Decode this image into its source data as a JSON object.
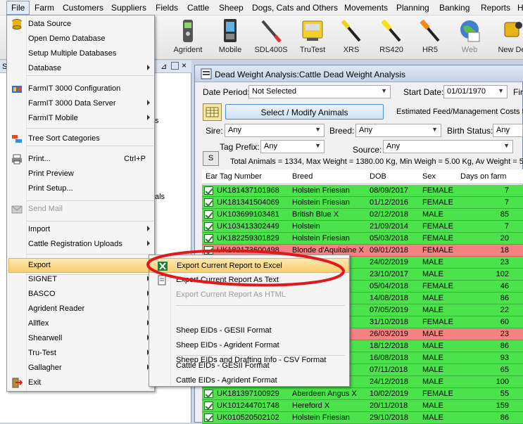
{
  "menubar": [
    "File",
    "Farm",
    "Customers",
    "Suppliers",
    "Fields",
    "Cattle",
    "Sheep",
    "Dogs, Cats and Others",
    "Movements",
    "Planning",
    "Banking",
    "Reports",
    "H"
  ],
  "toolbar": [
    {
      "label": "Agrident",
      "icon": "agrident-reader-icon"
    },
    {
      "label": "Mobile",
      "icon": "mobile-device-icon"
    },
    {
      "label": "SDL400S",
      "icon": "sdl400s-wand-icon"
    },
    {
      "label": "TruTest",
      "icon": "trutest-indicator-icon"
    },
    {
      "label": "XRS",
      "icon": "xrs-wand-icon"
    },
    {
      "label": "RS420",
      "icon": "rs420-wand-icon"
    },
    {
      "label": "HR5",
      "icon": "hr5-wand-icon"
    },
    {
      "label": "Web",
      "icon": "globe-icon"
    },
    {
      "label": "New De",
      "icon": "new-device-icon"
    }
  ],
  "left_panel": {
    "fragments": [
      "S",
      "s",
      "als"
    ]
  },
  "window": {
    "title": "Dead Weight Analysis:Cattle Dead Weight Analysis",
    "date_period_label": "Date Period:",
    "date_period_value": "Not Selected",
    "start_date_label": "Start Date:",
    "start_date_value": "01/01/1970",
    "fin_label": "Fin",
    "select_button": "Select / Modify Animals",
    "feed_costs_label": "Estimated Feed/Management Costs P",
    "sire_label": "Sire:",
    "sire_value": "Any",
    "breed_label": "Breed:",
    "breed_value": "Any",
    "birth_status_label": "Birth Status:",
    "birth_status_value": "Any",
    "tag_prefix_label": "Tag Prefix:",
    "tag_prefix_value": "Any",
    "source_label": "Source:",
    "source_value": "Any",
    "s_button": "S",
    "summary": "Total Animals = 1334, Max Weight = 1380.00 Kg, Min Weigh = 5.00 Kg, Av Weight = 5"
  },
  "grid": {
    "columns": [
      "Ear Tag Number",
      "Breed",
      "DOB",
      "Sex",
      "Days on farm"
    ],
    "rows": [
      {
        "tag": "UK181437101968",
        "breed": "Holstein Friesian",
        "dob": "08/09/2017",
        "sex": "FEMALE",
        "days": "7",
        "status": "ok"
      },
      {
        "tag": "UK181341504069",
        "breed": "Holstein Friesian",
        "dob": "01/12/2016",
        "sex": "FEMALE",
        "days": "7",
        "status": "ok"
      },
      {
        "tag": "UK103699103481",
        "breed": "British Blue X",
        "dob": "02/12/2018",
        "sex": "MALE",
        "days": "85",
        "status": "ok"
      },
      {
        "tag": "UK103413302449",
        "breed": "Holstein",
        "dob": "21/09/2014",
        "sex": "FEMALE",
        "days": "7",
        "status": "ok"
      },
      {
        "tag": "UK182259301829",
        "breed": "Holstein Friesian",
        "dob": "05/03/2018",
        "sex": "FEMALE",
        "days": "20",
        "status": "ok"
      },
      {
        "tag": "UK182173600498",
        "breed": "Blonde d'Aquitaine X",
        "dob": "09/01/2018",
        "sex": "FEMALE",
        "days": "18",
        "status": "alert"
      },
      {
        "tag": "",
        "breed": "",
        "dob": "24/02/2019",
        "sex": "MALE",
        "days": "23",
        "status": "ok"
      },
      {
        "tag": "",
        "breed": "X",
        "dob": "23/10/2017",
        "sex": "MALE",
        "days": "102",
        "status": "ok"
      },
      {
        "tag": "",
        "breed": "n",
        "dob": "05/04/2018",
        "sex": "FEMALE",
        "days": "46",
        "status": "ok"
      },
      {
        "tag": "",
        "breed": "",
        "dob": "14/08/2018",
        "sex": "MALE",
        "days": "86",
        "status": "ok"
      },
      {
        "tag": "",
        "breed": "",
        "dob": "07/05/2019",
        "sex": "MALE",
        "days": "22",
        "status": "ok"
      },
      {
        "tag": "",
        "breed": "",
        "dob": "31/10/2018",
        "sex": "FEMALE",
        "days": "60",
        "status": "ok"
      },
      {
        "tag": "",
        "breed": "X",
        "dob": "26/03/2019",
        "sex": "MALE",
        "days": "23",
        "status": "alert"
      },
      {
        "tag": "",
        "breed": "",
        "dob": "18/12/2018",
        "sex": "MALE",
        "days": "86",
        "status": "ok"
      },
      {
        "tag": "",
        "breed": "",
        "dob": "16/08/2018",
        "sex": "MALE",
        "days": "93",
        "status": "ok"
      },
      {
        "tag": "",
        "breed": "",
        "dob": "07/11/2018",
        "sex": "MALE",
        "days": "65",
        "status": "ok"
      },
      {
        "tag": "",
        "breed": "",
        "dob": "24/12/2018",
        "sex": "MALE",
        "days": "100",
        "status": "ok"
      },
      {
        "tag": "UK181397100929",
        "breed": "Aberdeen Angus X",
        "dob": "10/02/2019",
        "sex": "FEMALE",
        "days": "55",
        "status": "ok"
      },
      {
        "tag": "UK101244701748",
        "breed": "Hereford X",
        "dob": "20/11/2018",
        "sex": "MALE",
        "days": "159",
        "status": "ok"
      },
      {
        "tag": "UK010520502102",
        "breed": "Holstein Friesian",
        "dob": "29/10/2018",
        "sex": "MALE",
        "days": "86",
        "status": "ok"
      }
    ]
  },
  "file_menu": {
    "items": [
      {
        "label": "Data Source",
        "icon": "database-icon"
      },
      {
        "label": "Open Demo Database"
      },
      {
        "label": "Setup Multiple Databases"
      },
      {
        "label": "Database",
        "submenu": true
      },
      {
        "label": "FarmIT 3000 Configuration",
        "icon": "configuration-icon"
      },
      {
        "label": "FarmIT 3000 Data Server",
        "submenu": true
      },
      {
        "label": "FarmIT Mobile",
        "submenu": true
      },
      {
        "label": "Tree Sort Categories",
        "icon": "tree-sort-icon"
      },
      {
        "label": "Print...",
        "shortcut": "Ctrl+P",
        "icon": "printer-icon"
      },
      {
        "label": "Print Preview"
      },
      {
        "label": "Print Setup..."
      },
      {
        "label": "Send Mail",
        "disabled": true,
        "icon": "mail-icon"
      },
      {
        "label": "Import",
        "submenu": true
      },
      {
        "label": "Cattle Registration Uploads",
        "submenu": true
      },
      {
        "label": "Export",
        "submenu": true
      },
      {
        "label": "SIGNET",
        "submenu": true
      },
      {
        "label": "BASCO",
        "submenu": true
      },
      {
        "label": "Agrident Reader",
        "submenu": true
      },
      {
        "label": "Allflex",
        "submenu": true
      },
      {
        "label": "Shearwell",
        "submenu": true
      },
      {
        "label": "Tru-Test",
        "submenu": true
      },
      {
        "label": "Gallagher",
        "submenu": true
      },
      {
        "label": "Exit",
        "icon": "exit-icon"
      }
    ]
  },
  "export_menu": {
    "items": [
      {
        "label": "Export Current Report to  Excel",
        "icon": "excel-icon"
      },
      {
        "label": "Export Current Report As Text",
        "icon": "text-file-icon"
      },
      {
        "label": "Export Current Report As HTML",
        "disabled": true
      },
      {
        "label": "Sheep EIDs - GESII Format"
      },
      {
        "label": "Sheep EIDs - Agrident Format"
      },
      {
        "label": "Sheep EIDs and Drafting Info - CSV Format"
      },
      {
        "label": "Cattle EIDs - GESII Format"
      },
      {
        "label": "Cattle EIDs - Agrident Format"
      }
    ]
  },
  "colors": {
    "row_ok": "#4be24b",
    "row_alert": "#f58283",
    "highlight": "#f9cf6e",
    "annotation_ring": "#e0191e"
  }
}
